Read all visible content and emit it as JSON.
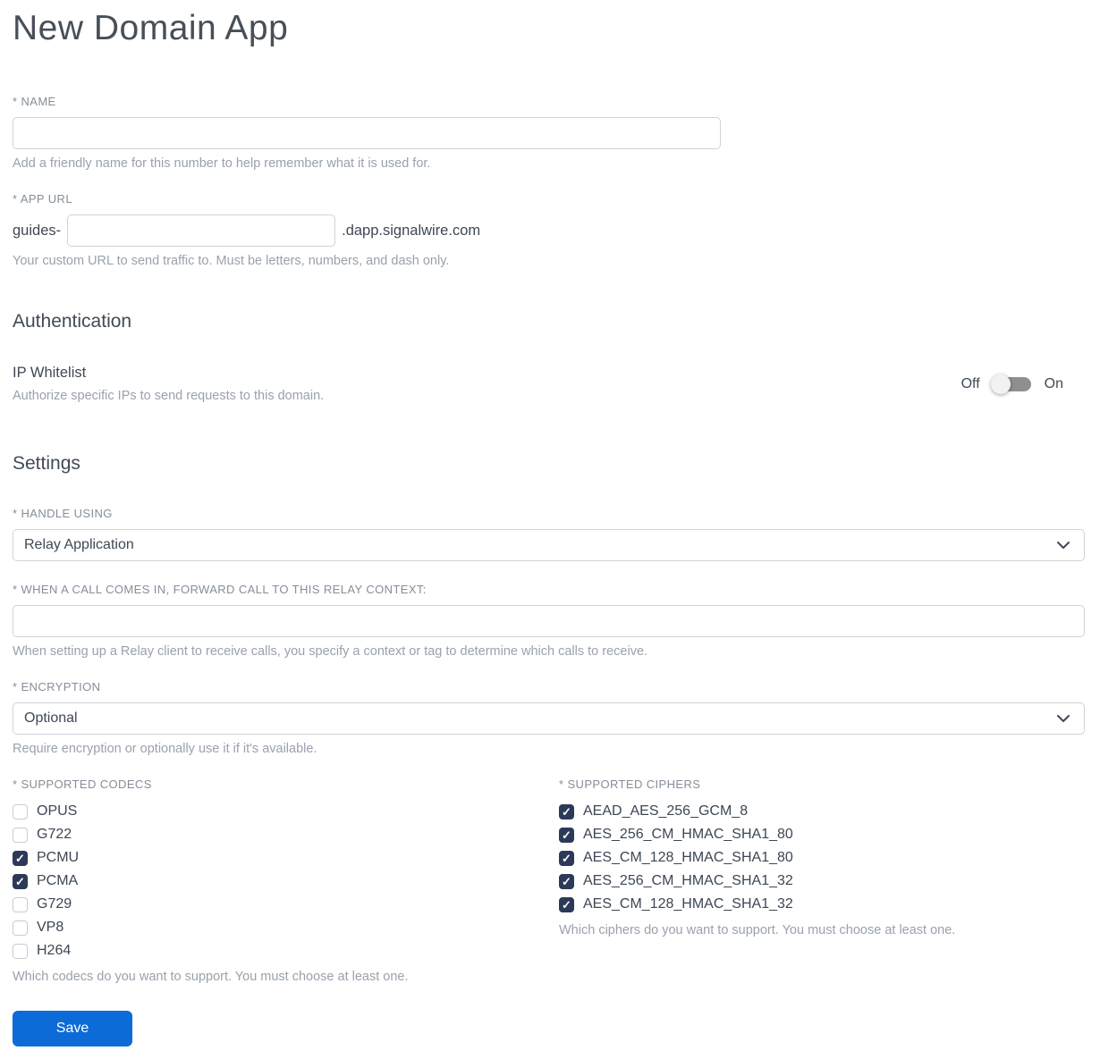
{
  "page": {
    "title": "New Domain App"
  },
  "name_field": {
    "label": "* NAME",
    "value": "",
    "help": "Add a friendly name for this number to help remember what it is used for."
  },
  "app_url_field": {
    "label": "* APP URL",
    "prefix": "guides-",
    "value": "",
    "suffix": ".dapp.signalwire.com",
    "help": "Your custom URL to send traffic to. Must be letters, numbers, and dash only."
  },
  "authentication": {
    "heading": "Authentication",
    "ip_whitelist": {
      "label": "IP Whitelist",
      "help": "Authorize specific IPs to send requests to this domain.",
      "off_label": "Off",
      "on_label": "On",
      "state": "off"
    }
  },
  "settings": {
    "heading": "Settings",
    "handle_using": {
      "label": "* HANDLE USING",
      "selected": "Relay Application"
    },
    "relay_context": {
      "label": "* WHEN A CALL COMES IN, FORWARD CALL TO THIS RELAY CONTEXT:",
      "value": "",
      "help": "When setting up a Relay client to receive calls, you specify a context or tag to determine which calls to receive."
    },
    "encryption": {
      "label": "* ENCRYPTION",
      "selected": "Optional",
      "help": "Require encryption or optionally use it if it's available."
    },
    "codecs": {
      "label": "* SUPPORTED CODECS",
      "help": "Which codecs do you want to support. You must choose at least one.",
      "options": [
        {
          "label": "OPUS",
          "checked": false
        },
        {
          "label": "G722",
          "checked": false
        },
        {
          "label": "PCMU",
          "checked": true
        },
        {
          "label": "PCMA",
          "checked": true
        },
        {
          "label": "G729",
          "checked": false
        },
        {
          "label": "VP8",
          "checked": false
        },
        {
          "label": "H264",
          "checked": false
        }
      ]
    },
    "ciphers": {
      "label": "* SUPPORTED CIPHERS",
      "help": "Which ciphers do you want to support. You must choose at least one.",
      "options": [
        {
          "label": "AEAD_AES_256_GCM_8",
          "checked": true
        },
        {
          "label": "AES_256_CM_HMAC_SHA1_80",
          "checked": true
        },
        {
          "label": "AES_CM_128_HMAC_SHA1_80",
          "checked": true
        },
        {
          "label": "AES_256_CM_HMAC_SHA1_32",
          "checked": true
        },
        {
          "label": "AES_CM_128_HMAC_SHA1_32",
          "checked": true
        }
      ]
    }
  },
  "actions": {
    "save_label": "Save"
  },
  "colors": {
    "primary_blue": "#0d6bd8",
    "checkbox_checked": "#2d3958",
    "toggle_track": "#8f8f8f",
    "input_border": "#ced3da"
  }
}
